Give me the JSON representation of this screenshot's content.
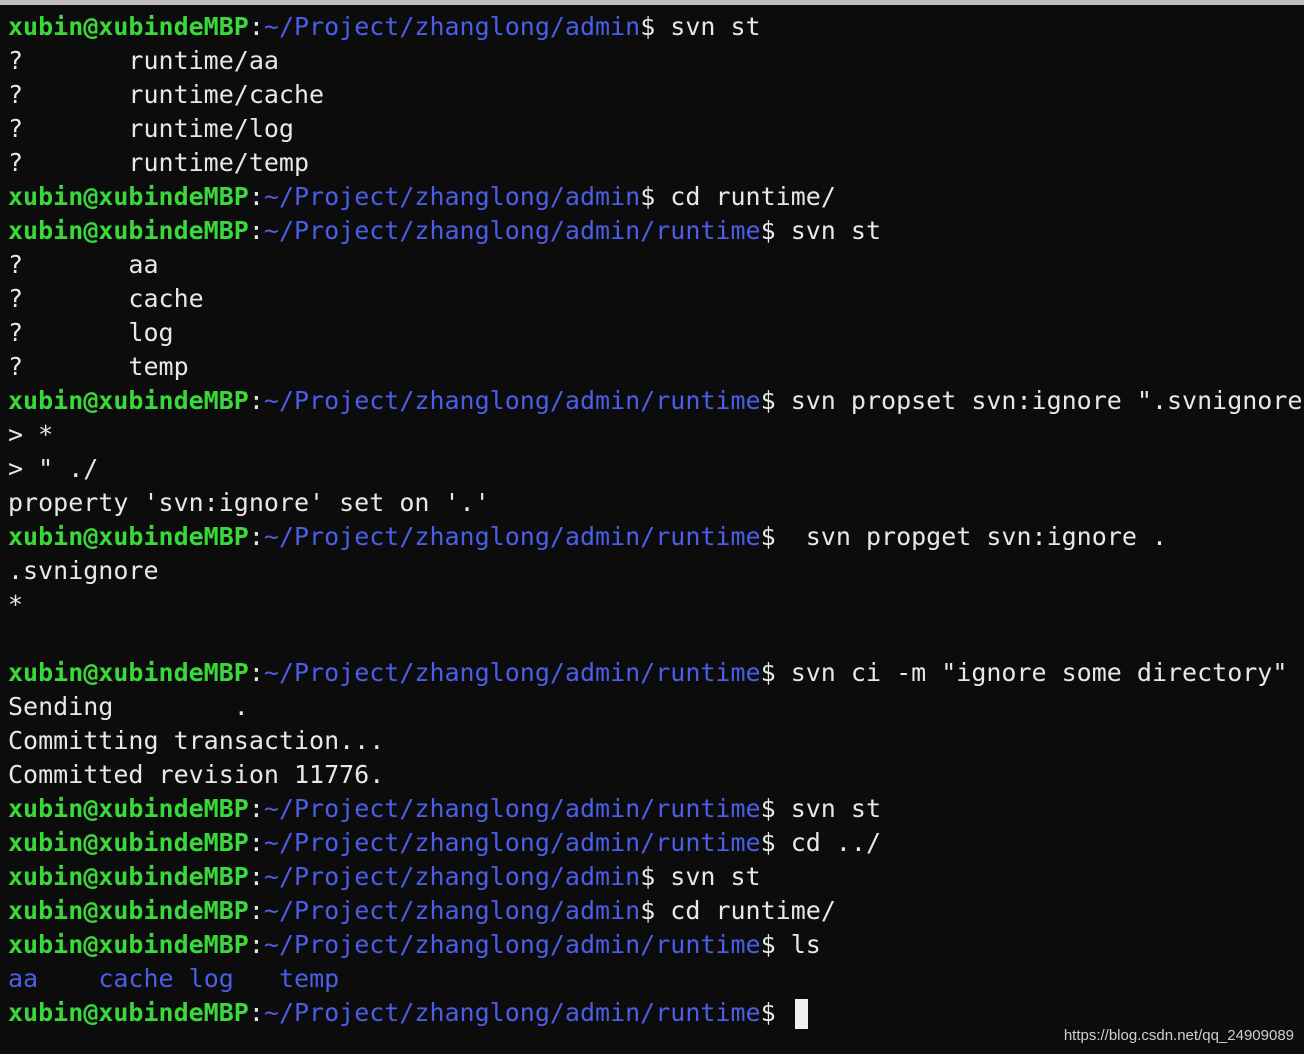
{
  "prompt": {
    "user": "xubin@xubindeMBP",
    "colon": ":",
    "dollar": "$",
    "path_admin": "~/Project/zhanglong/admin",
    "path_runtime": "~/Project/zhanglong/admin/runtime"
  },
  "lines": [
    {
      "type": "prompt",
      "path": "~/Project/zhanglong/admin",
      "cmd": " svn st"
    },
    {
      "type": "out",
      "text": "?       runtime/aa"
    },
    {
      "type": "out",
      "text": "?       runtime/cache"
    },
    {
      "type": "out",
      "text": "?       runtime/log"
    },
    {
      "type": "out",
      "text": "?       runtime/temp"
    },
    {
      "type": "prompt",
      "path": "~/Project/zhanglong/admin",
      "cmd": " cd runtime/"
    },
    {
      "type": "prompt",
      "path": "~/Project/zhanglong/admin/runtime",
      "cmd": " svn st"
    },
    {
      "type": "out",
      "text": "?       aa"
    },
    {
      "type": "out",
      "text": "?       cache"
    },
    {
      "type": "out",
      "text": "?       log"
    },
    {
      "type": "out",
      "text": "?       temp"
    },
    {
      "type": "prompt",
      "path": "~/Project/zhanglong/admin/runtime",
      "cmd": " svn propset svn:ignore \".svnignore"
    },
    {
      "type": "out",
      "text": "> *"
    },
    {
      "type": "out",
      "text": "> \" ./"
    },
    {
      "type": "out",
      "text": "property 'svn:ignore' set on '.'"
    },
    {
      "type": "prompt",
      "path": "~/Project/zhanglong/admin/runtime",
      "cmd": "  svn propget svn:ignore ."
    },
    {
      "type": "out",
      "text": ".svnignore"
    },
    {
      "type": "out",
      "text": "*"
    },
    {
      "type": "out",
      "text": ""
    },
    {
      "type": "prompt",
      "path": "~/Project/zhanglong/admin/runtime",
      "cmd": " svn ci -m \"ignore some directory\""
    },
    {
      "type": "out",
      "text": "Sending        ."
    },
    {
      "type": "out",
      "text": "Committing transaction..."
    },
    {
      "type": "out",
      "text": "Committed revision 11776."
    },
    {
      "type": "prompt",
      "path": "~/Project/zhanglong/admin/runtime",
      "cmd": " svn st"
    },
    {
      "type": "prompt",
      "path": "~/Project/zhanglong/admin/runtime",
      "cmd": " cd ../"
    },
    {
      "type": "prompt",
      "path": "~/Project/zhanglong/admin",
      "cmd": " svn st"
    },
    {
      "type": "prompt",
      "path": "~/Project/zhanglong/admin",
      "cmd": " cd runtime/"
    },
    {
      "type": "prompt",
      "path": "~/Project/zhanglong/admin/runtime",
      "cmd": " ls"
    },
    {
      "type": "ls",
      "items": [
        "aa",
        "cache",
        "log",
        "temp"
      ],
      "spacing": [
        "    ",
        " ",
        "   ",
        ""
      ]
    },
    {
      "type": "prompt",
      "path": "~/Project/zhanglong/admin/runtime",
      "cmd": " ",
      "cursor": true
    }
  ],
  "watermark": "https://blog.csdn.net/qq_24909089",
  "colors": {
    "background": "#0c0c0c",
    "user": "#3ad83a",
    "path": "#4a5ee8",
    "text": "#e8e8e8",
    "cursor": "#f0f0f0"
  }
}
